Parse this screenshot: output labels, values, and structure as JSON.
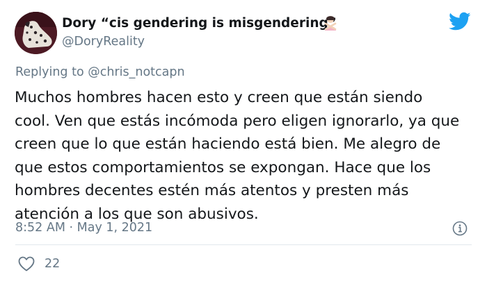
{
  "tweet": {
    "display_name": "Dory “cis gendering is misgendering”",
    "handle": "@DoryReality",
    "replying_prefix": "Replying to ",
    "replying_to": "@chris_notcapn",
    "body_lines": [
      "Muchos hombres hacen esto y creen que están siendo",
      "cool. Ven que estás incómoda pero eligen ignorarlo, ya que",
      "creen que lo que están haciendo está bien. Me alegro de",
      "que estos comportamientos se expongan. Hace que los",
      "hombres decentes estén más atentos y presten más",
      "atención a los que son abusivos."
    ],
    "timestamp": "8:52 AM · May 1, 2021",
    "like_count": "22"
  },
  "colors": {
    "twitter_blue": "#1da1f2",
    "secondary_text": "#657786",
    "divider": "#e1e8ed"
  },
  "icons": {
    "logo": "twitter-bird-icon",
    "info": "info-icon",
    "like": "heart-icon",
    "name_emoji": "person-gesturing-no-emoji"
  }
}
